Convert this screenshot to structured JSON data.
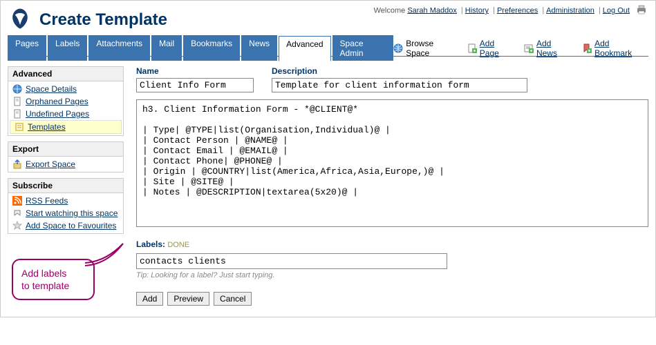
{
  "header": {
    "title": "Create Template",
    "welcome_prefix": "Welcome ",
    "user": "Sarah Maddox",
    "links": {
      "history": "History",
      "preferences": "Preferences",
      "administration": "Administration",
      "logout": "Log Out"
    }
  },
  "tabs": [
    {
      "label": "Pages"
    },
    {
      "label": "Labels"
    },
    {
      "label": "Attachments"
    },
    {
      "label": "Mail"
    },
    {
      "label": "Bookmarks"
    },
    {
      "label": "News"
    },
    {
      "label": "Advanced",
      "active": true
    },
    {
      "label": "Space Admin"
    }
  ],
  "space_actions": {
    "browse": "Browse Space",
    "add_page": "Add Page",
    "add_news": "Add News",
    "add_bookmark": "Add Bookmark"
  },
  "sidebar": {
    "panels": [
      {
        "title": "Advanced",
        "items": [
          {
            "label": "Space Details",
            "icon": "globe"
          },
          {
            "label": "Orphaned Pages",
            "icon": "page"
          },
          {
            "label": "Undefined Pages",
            "icon": "page"
          },
          {
            "label": "Templates",
            "icon": "template",
            "selected": true
          }
        ]
      },
      {
        "title": "Export",
        "items": [
          {
            "label": "Export Space",
            "icon": "export"
          }
        ]
      },
      {
        "title": "Subscribe",
        "items": [
          {
            "label": "RSS Feeds",
            "icon": "rss"
          },
          {
            "label": "Start watching this space",
            "icon": "watch"
          },
          {
            "label": "Add Space to Favourites",
            "icon": "star"
          }
        ]
      }
    ]
  },
  "form": {
    "name_label": "Name",
    "name_value": "Client Info Form",
    "desc_label": "Description",
    "desc_value": "Template for client information form",
    "editor_value": "h3. Client Information Form - *@CLIENT@*\n\n| Type| @TYPE|list(Organisation,Individual)@ |\n| Contact Person | @NAME@ |\n| Contact Email | @EMAIL@ |\n| Contact Phone| @PHONE@ |\n| Origin | @COUNTRY|list(America,Africa,Asia,Europe,)@ |\n| Site | @SITE@ |\n| Notes | @DESCRIPTION|textarea(5x20)@ |",
    "labels_label": "Labels:",
    "labels_done": "DONE",
    "labels_value": "contacts clients",
    "tip_prefix": "Tip: ",
    "tip_text": "Looking for a label? Just start typing.",
    "buttons": {
      "add": "Add",
      "preview": "Preview",
      "cancel": "Cancel"
    }
  },
  "callout": {
    "line1": "Add labels",
    "line2": "to template"
  }
}
